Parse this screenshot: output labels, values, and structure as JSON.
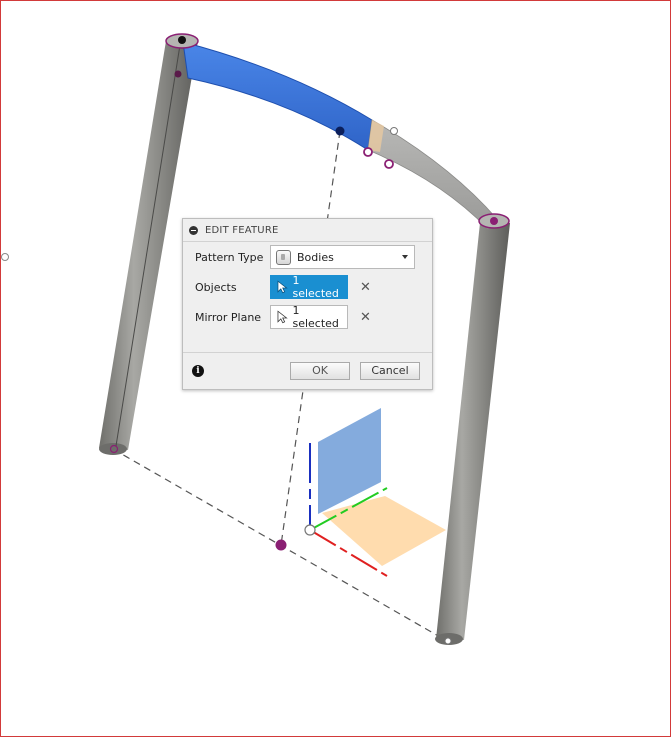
{
  "dialog": {
    "title": "EDIT FEATURE",
    "pattern_type_label": "Pattern Type",
    "pattern_type_value": "Bodies",
    "objects_label": "Objects",
    "objects_value": "1 selected",
    "mirror_plane_label": "Mirror Plane",
    "mirror_plane_value": "1 selected",
    "ok_label": "OK",
    "cancel_label": "Cancel",
    "clear_symbol": "✕",
    "info_symbol": "i"
  },
  "colors": {
    "viewport_border": "#d23a3a",
    "selection_blue": "#1a8fd1",
    "body_gray": "#8a8a86",
    "selected_body_blue": "#3f79d9",
    "marker_purple": "#8a1f73",
    "xz_plane": "#ffc06b",
    "yz_plane": "#5b8fd1",
    "axis_x": "#e02020",
    "axis_y": "#22cc22",
    "axis_z": "#1a2fbf"
  },
  "icons": [
    "collapse-icon",
    "bodies-icon",
    "cursor-icon",
    "clear-icon",
    "info-icon",
    "dropdown-arrow-icon"
  ]
}
